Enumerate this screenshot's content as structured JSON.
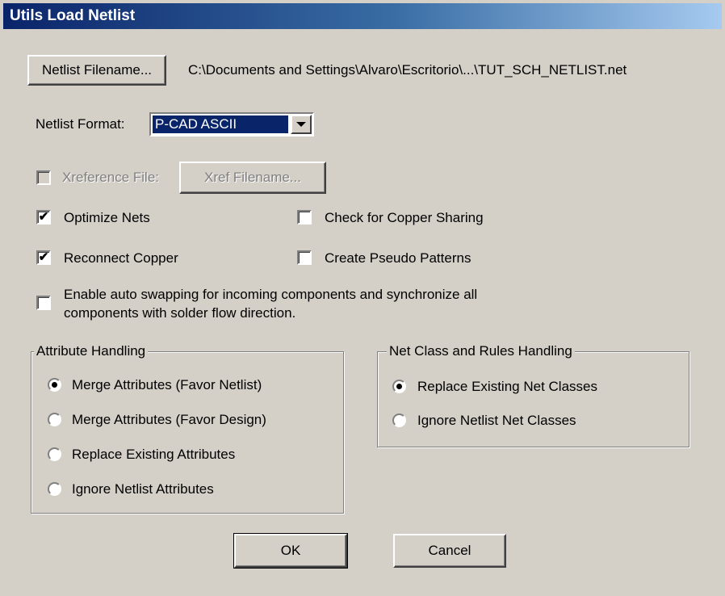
{
  "window": {
    "title": "Utils Load Netlist"
  },
  "netlist": {
    "filename_button": "Netlist Filename...",
    "filename_path": "C:\\Documents and Settings\\Alvaro\\Escritorio\\...\\TUT_SCH_NETLIST.net",
    "format_label": "Netlist Format:",
    "format_value": "P-CAD ASCII"
  },
  "options": {
    "xref_label": "Xreference File:",
    "xref_checked": false,
    "xref_enabled": false,
    "xref_button": "Xref Filename...",
    "optimize_nets": {
      "label": "Optimize Nets",
      "checked": true
    },
    "reconnect_copper": {
      "label": "Reconnect Copper",
      "checked": true
    },
    "check_copper_sharing": {
      "label": "Check for Copper Sharing",
      "checked": false
    },
    "create_pseudo_patterns": {
      "label": "Create Pseudo Patterns",
      "checked": false
    },
    "auto_swap": {
      "line1": "Enable auto swapping for incoming components and synchronize all",
      "line2": "components with solder flow direction.",
      "checked": false
    }
  },
  "attribute_handling": {
    "title": "Attribute Handling",
    "options": [
      {
        "label": "Merge Attributes (Favor Netlist)",
        "selected": true
      },
      {
        "label": "Merge Attributes (Favor Design)",
        "selected": false
      },
      {
        "label": "Replace Existing Attributes",
        "selected": false
      },
      {
        "label": "Ignore Netlist Attributes",
        "selected": false
      }
    ]
  },
  "net_class_handling": {
    "title": "Net Class and Rules Handling",
    "options": [
      {
        "label": "Replace Existing Net Classes",
        "selected": true
      },
      {
        "label": "Ignore Netlist Net Classes",
        "selected": false
      }
    ]
  },
  "footer": {
    "ok_label": "OK",
    "cancel_label": "Cancel"
  }
}
